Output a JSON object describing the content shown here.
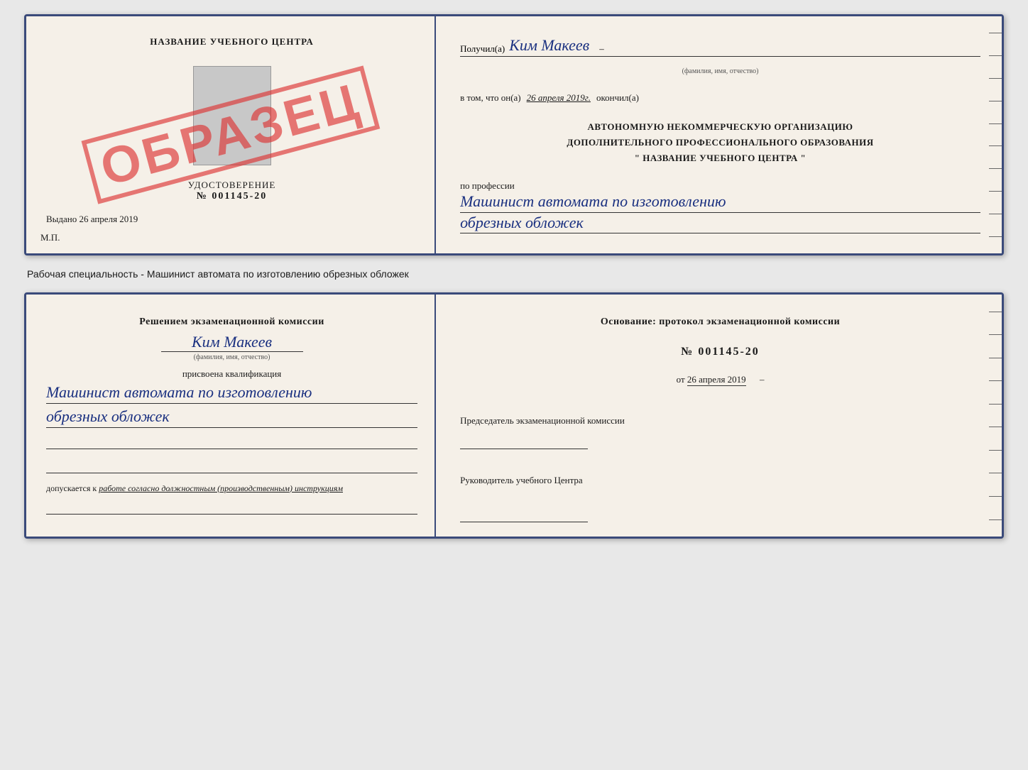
{
  "topDoc": {
    "left": {
      "schoolName": "НАЗВАНИЕ УЧЕБНОГО ЦЕНТРА",
      "certTitle": "УДОСТОВЕРЕНИЕ",
      "certNumber": "№ 001145-20",
      "issuedLabel": "Выдано",
      "issuedDate": "26 апреля 2019",
      "mpLabel": "М.П.",
      "stampText": "ОБРАЗЕЦ"
    },
    "right": {
      "recipientPrefix": "Получил(а)",
      "recipientName": "Ким Макеев",
      "recipientSubLabel": "(фамилия, имя, отчество)",
      "datePrefix": "в том, что он(а)",
      "dateValue": "26 апреля 2019г.",
      "dateSuffix": "окончил(а)",
      "orgLine1": "АВТОНОМНУЮ НЕКОММЕРЧЕСКУЮ ОРГАНИЗАЦИЮ",
      "orgLine2": "ДОПОЛНИТЕЛЬНОГО ПРОФЕССИОНАЛЬНОГО ОБРАЗОВАНИЯ",
      "orgLine3": "\" НАЗВАНИЕ УЧЕБНОГО ЦЕНТРА \"",
      "professionLabel": "по профессии",
      "professionLine1": "Машинист автомата по изготовлению",
      "professionLine2": "обрезных обложек"
    }
  },
  "caption": {
    "text": "Рабочая специальность - Машинист автомата по изготовлению обрезных обложек"
  },
  "bottomDoc": {
    "left": {
      "decisionTitle": "Решением экзаменационной комиссии",
      "personName": "Ким Макеев",
      "personSubLabel": "(фамилия, имя, отчество)",
      "qualificationLabel": "присвоена квалификация",
      "qualificationLine1": "Машинист автомата по изготовлению",
      "qualificationLine2": "обрезных обложек",
      "permissionPrefix": "допускается к",
      "permissionText": "работе согласно должностным (производственным) инструкциям"
    },
    "right": {
      "basisLabel": "Основание: протокол экзаменационной комиссии",
      "protocolNumber": "№ 001145-20",
      "protocolDatePrefix": "от",
      "protocolDate": "26 апреля 2019",
      "chairmanLabel": "Председатель экзаменационной комиссии",
      "directorLabel": "Руководитель учебного Центра"
    }
  }
}
